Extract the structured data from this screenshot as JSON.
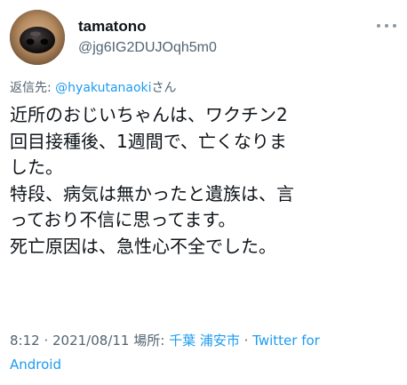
{
  "user": {
    "display_name": "tamatono",
    "handle": "@jg6IG2DUJOqh5m0",
    "avatar_icon": "dog-nose-avatar"
  },
  "more_icon": "more-horizontal-icon",
  "reply": {
    "prefix": "返信先: ",
    "mention": "@hyakutanaoki",
    "suffix": "さん"
  },
  "tweet_lines": [
    "近所のおじいちゃんは、ワクチン2",
    "回目接種後、1週間で、亡くなりま",
    "した。",
    "特段、病気は無かったと遺族は、言",
    "っており不信に思ってます。",
    "死亡原因は、急性心不全でした。"
  ],
  "meta": {
    "time": "8:12",
    "separator1": " · ",
    "date": "2021/08/11",
    "place_label": " 場所: ",
    "place": "千葉 浦安市",
    "separator2": " · ",
    "source_line1": "Twitter for",
    "source_line2": "Android"
  },
  "colors": {
    "link": "#1d9bf0",
    "secondary_text": "#536471",
    "primary_text": "#0f1419"
  }
}
